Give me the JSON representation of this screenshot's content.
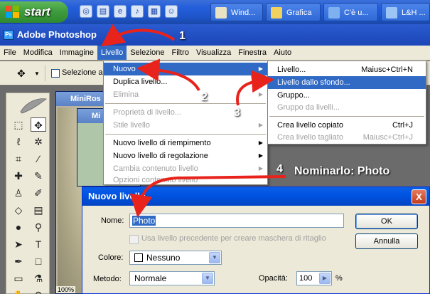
{
  "taskbar": {
    "start_label": "start",
    "buttons": [
      {
        "label": "Wind..."
      },
      {
        "label": "Grafica"
      },
      {
        "label": "C'è u..."
      },
      {
        "label": "L&H ..."
      }
    ]
  },
  "window": {
    "title": "Adobe Photoshop"
  },
  "menubar": {
    "items": [
      "File",
      "Modifica",
      "Immagine",
      "Livello",
      "Selezione",
      "Filtro",
      "Visualizza",
      "Finestra",
      "Aiuto"
    ]
  },
  "optionsbar": {
    "checkbox_label": "Selezione au"
  },
  "documents": {
    "doc1_title": "MiniRos",
    "doc2_title": "Mi",
    "zoom": "100%"
  },
  "livello_menu": {
    "items": [
      {
        "label": "Nuovo",
        "state": "highlighted",
        "submenu": true
      },
      {
        "label": "Duplica livello...",
        "state": "enabled"
      },
      {
        "label": "Elimina",
        "state": "disabled",
        "submenu": true
      },
      {
        "label": "Proprietà di livello...",
        "state": "disabled"
      },
      {
        "label": "Stile livello",
        "state": "disabled",
        "submenu": true
      },
      {
        "label": "Nuovo livello di riempimento",
        "state": "enabled",
        "submenu": true
      },
      {
        "label": "Nuovo livello di regolazione",
        "state": "enabled",
        "submenu": true
      },
      {
        "label": "Cambia contenuto livello",
        "state": "disabled",
        "submenu": true
      },
      {
        "label": "Opzioni contenuto livello",
        "state": "disabled"
      }
    ]
  },
  "nuovo_submenu": {
    "items": [
      {
        "label": "Livello...",
        "shortcut": "Maiusc+Ctrl+N",
        "state": "enabled"
      },
      {
        "label": "Livello dallo sfondo...",
        "shortcut": "",
        "state": "highlighted"
      },
      {
        "label": "Gruppo...",
        "shortcut": "",
        "state": "enabled"
      },
      {
        "label": "Gruppo da livelli...",
        "shortcut": "",
        "state": "disabled"
      },
      {
        "label": "Crea livello copiato",
        "shortcut": "Ctrl+J",
        "state": "enabled"
      },
      {
        "label": "Crea livello tagliato",
        "shortcut": "Maiusc+Ctrl+J",
        "state": "disabled"
      }
    ]
  },
  "dialog": {
    "title": "Nuovo livello",
    "close_label": "X",
    "name_label": "Nome:",
    "name_value": "Photo",
    "checkbox_label": "Usa livello precedente per creare maschera di ritaglio",
    "color_label": "Colore:",
    "color_value": "Nessuno",
    "mode_label": "Metodo:",
    "mode_value": "Normale",
    "opacity_label": "Opacità:",
    "opacity_value": "100",
    "opacity_unit": "%",
    "ok_label": "OK",
    "cancel_label": "Annulla"
  },
  "annotations": {
    "step1": "1",
    "step2": "2",
    "step3": "3",
    "step4": "4",
    "step4_text": "Nominarlo: Photo",
    "arrow_color": "#e8231c"
  }
}
